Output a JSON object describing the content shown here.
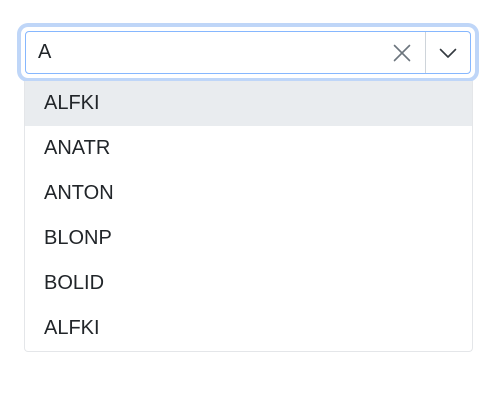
{
  "combobox": {
    "value": "A",
    "clear_icon": "close-icon",
    "toggle_icon": "chevron-down-icon"
  },
  "dropdown": {
    "items": [
      {
        "label": "ALFKI",
        "highlighted": true
      },
      {
        "label": "ANATR",
        "highlighted": false
      },
      {
        "label": "ANTON",
        "highlighted": false
      },
      {
        "label": "BLONP",
        "highlighted": false
      },
      {
        "label": "BOLID",
        "highlighted": false
      },
      {
        "label": "ALFKI",
        "highlighted": false
      }
    ]
  },
  "colors": {
    "focus_ring": "#bfd6f8",
    "focus_border": "#86b7fe",
    "highlight_bg": "#e9ecef",
    "text": "#212529"
  }
}
